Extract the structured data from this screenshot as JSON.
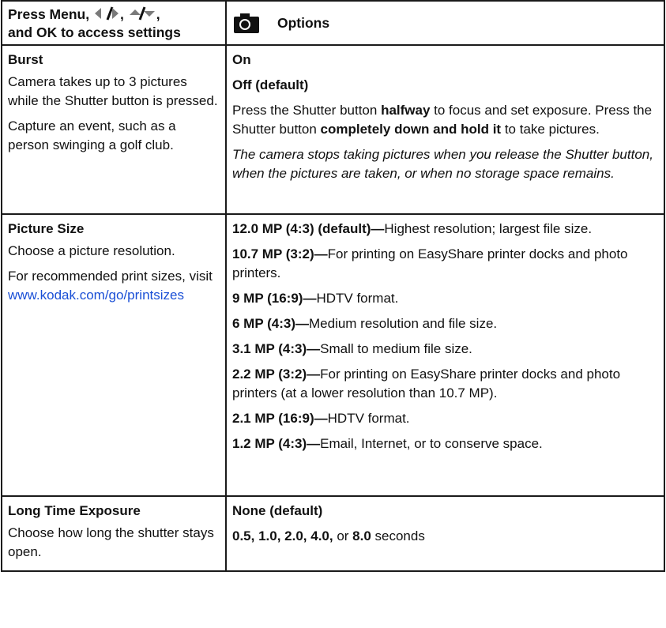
{
  "header": {
    "left_line1": "Press Menu,",
    "left_line2": "and OK to access settings",
    "right_title": "Options",
    "camera_icon": "camera-icon",
    "leftright_icon": "left-right-arrows-icon",
    "updown_icon": "up-down-arrows-icon"
  },
  "burst": {
    "name": "Burst",
    "desc1": "Camera takes up to 3 pictures while the Shutter button is pressed.",
    "desc2": "Capture an event, such as a person swinging a golf club.",
    "opt_on": "On",
    "opt_off": "Off (default)",
    "p1_a": "Press the Shutter button ",
    "p1_b": "halfway",
    "p1_c": " to focus and set exposure. Press the Shutter button ",
    "p1_d": "completely down and hold it",
    "p1_e": " to take pictures.",
    "note": "The camera stops taking pictures when you release the Shutter button, when the pictures are taken, or when no storage space remains."
  },
  "picture_size": {
    "name": "Picture Size",
    "desc1": "Choose a picture resolution.",
    "desc2": "For recommended print sizes, visit",
    "link": "www.kodak.com/go/printsizes",
    "options": [
      {
        "label": "12.0 MP (4:3) (default)—",
        "text": "Highest resolution; largest file size."
      },
      {
        "label": "10.7 MP (3:2)—",
        "text": "For printing on EasyShare printer docks and photo printers."
      },
      {
        "label": "9 MP (16:9)—",
        "text": "HDTV format."
      },
      {
        "label": "6 MP (4:3)—",
        "text": "Medium resolution and file size."
      },
      {
        "label": "3.1 MP (4:3)—",
        "text": "Small to medium file size."
      },
      {
        "label": "2.2 MP (3:2)—",
        "text": "For printing on EasyShare printer docks and photo printers (at a lower resolution than 10.7 MP)."
      },
      {
        "label": "2.1 MP (16:9)—",
        "text": "HDTV format."
      },
      {
        "label": "1.2 MP (4:3)—",
        "text": "Email, Internet, or to conserve space."
      }
    ]
  },
  "long_time": {
    "name": "Long Time Exposure",
    "desc": "Choose how long the shutter stays open.",
    "opt_none": "None (default)",
    "val1": "0.5, 1.0, 2.0, 4.0,",
    "or_text": " or ",
    "val2": "8.0",
    "seconds": " seconds"
  }
}
